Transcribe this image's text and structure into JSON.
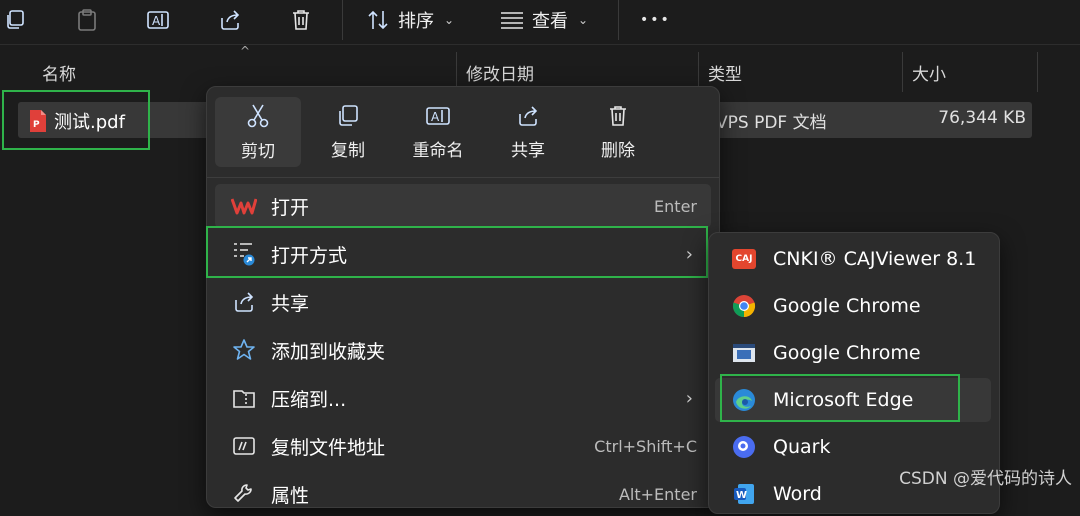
{
  "toolbar": {
    "sort_label": "排序",
    "view_label": "查看",
    "more_label": "•••"
  },
  "columns": {
    "name": "名称",
    "modified": "修改日期",
    "type": "类型",
    "size": "大小"
  },
  "file": {
    "name": "测试.pdf",
    "type": "VPS PDF 文档",
    "size": "76,344 KB"
  },
  "context_menu": {
    "quick_actions": [
      {
        "label": "剪切",
        "icon": "scissors-icon"
      },
      {
        "label": "复制",
        "icon": "copy-icon"
      },
      {
        "label": "重命名",
        "icon": "rename-icon"
      },
      {
        "label": "共享",
        "icon": "share-icon"
      },
      {
        "label": "删除",
        "icon": "trash-icon"
      }
    ],
    "items": [
      {
        "label": "打开",
        "shortcut": "Enter",
        "icon": "wps-icon"
      },
      {
        "label": "打开方式",
        "arrow": "›",
        "icon": "open-with-icon"
      },
      {
        "label": "共享",
        "icon": "share-icon"
      },
      {
        "label": "添加到收藏夹",
        "icon": "star-icon"
      },
      {
        "label": "压缩到...",
        "arrow": "›",
        "icon": "zip-folder-icon"
      },
      {
        "label": "复制文件地址",
        "shortcut": "Ctrl+Shift+C",
        "icon": "copy-path-icon"
      },
      {
        "label": "属性",
        "shortcut": "Alt+Enter",
        "icon": "wrench-icon"
      }
    ]
  },
  "open_with_menu": {
    "items": [
      {
        "label": "CNKI® CAJViewer 8.1",
        "icon": "caj-icon",
        "badge": "CAJ"
      },
      {
        "label": "Google Chrome",
        "icon": "chrome-icon"
      },
      {
        "label": "Google Chrome",
        "icon": "chrome-app-icon"
      },
      {
        "label": "Microsoft Edge",
        "icon": "edge-icon"
      },
      {
        "label": "Quark",
        "icon": "quark-icon"
      },
      {
        "label": "Word",
        "icon": "word-icon"
      }
    ]
  },
  "watermark": "CSDN @爱代码的诗人",
  "colors": {
    "background": "#1c1c1c",
    "menu": "#2c2c2c",
    "highlight_box": "#2fb34a",
    "wps_red": "#e0403a",
    "edge_blue": "#2a8ad8"
  }
}
